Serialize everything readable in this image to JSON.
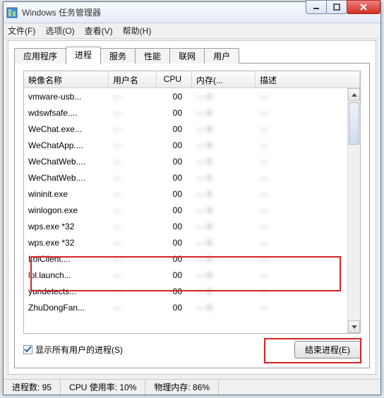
{
  "window": {
    "title": "Windows 任务管理器"
  },
  "menu": {
    "file": "文件(F)",
    "options": "选项(O)",
    "view": "查看(V)",
    "help": "帮助(H)"
  },
  "tabs": {
    "apps": "应用程序",
    "processes": "进程",
    "services": "服务",
    "performance": "性能",
    "network": "联网",
    "users": "用户"
  },
  "columns": {
    "name": "映像名称",
    "user": "用户名",
    "cpu": "CPU",
    "mem": "内存(...",
    "desc": "描述"
  },
  "rows": [
    {
      "name": "vmware-usb...",
      "cpu": "00"
    },
    {
      "name": "wdswfsafe....",
      "cpu": "00"
    },
    {
      "name": "WeChat.exe...",
      "cpu": "00"
    },
    {
      "name": "WeChatApp....",
      "cpu": "00"
    },
    {
      "name": "WeChatWeb....",
      "cpu": "00"
    },
    {
      "name": "WeChatWeb....",
      "cpu": "00"
    },
    {
      "name": "wininit.exe",
      "cpu": "00"
    },
    {
      "name": "winlogon.exe",
      "cpu": "00"
    },
    {
      "name": "wps.exe *32",
      "cpu": "00"
    },
    {
      "name": "wps.exe *32",
      "cpu": "00"
    },
    {
      "name": "LolClient....",
      "cpu": "00"
    },
    {
      "name": "lol.launch...",
      "cpu": "00"
    },
    {
      "name": "yundetects...",
      "cpu": "00"
    },
    {
      "name": "ZhuDongFan...",
      "cpu": "00"
    }
  ],
  "checkbox": {
    "label": "显示所有用户的进程(S)",
    "checked": true
  },
  "button": {
    "end_process": "结束进程(E)"
  },
  "status": {
    "processes": "进程数: 95",
    "cpu": "CPU 使用率: 10%",
    "mem": "物理内存: 86%"
  }
}
